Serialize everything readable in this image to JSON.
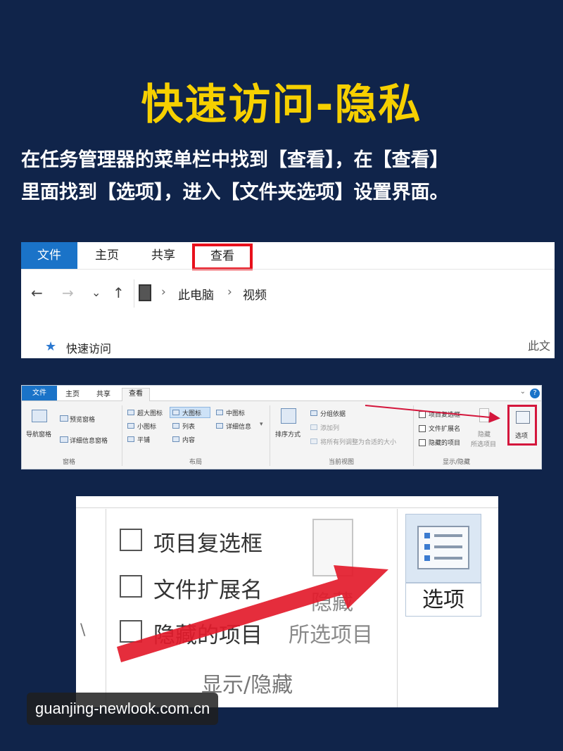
{
  "title": "快速访问-隐私",
  "description": {
    "line1": "在任务管理器的菜单栏中找到【查看】，在【查看】",
    "line2": "里面找到【选项】，进入【文件夹选项】设置界面。"
  },
  "panel1": {
    "tabs": [
      "文件",
      "主页",
      "共享",
      "查看"
    ],
    "nav": {
      "back": "←",
      "forward": "→",
      "dropdown": "⌄",
      "up": "↑"
    },
    "breadcrumb": [
      "此电脑",
      "视频"
    ],
    "quick_access": "快速访问",
    "right_cut": "此文"
  },
  "panel2": {
    "tabs": [
      "文件",
      "主页",
      "共享",
      "查看"
    ],
    "nav_pane": "导航窗格",
    "preview_pane": "预览窗格",
    "details_pane": "详细信息窗格",
    "group_panes": "窗格",
    "layout": {
      "extra_large": "超大图标",
      "large": "大图标",
      "medium": "中图标",
      "small": "小图标",
      "list": "列表",
      "details": "详细信息",
      "tiles": "平铺",
      "content": "内容",
      "group": "布局"
    },
    "current_view": {
      "sort": "排序方式",
      "group_by": "分组依据",
      "add_column": "添加列",
      "fit_columns": "将所有列调整为合适的大小",
      "group": "当前视图"
    },
    "show_hide": {
      "item_checkbox": "项目复选框",
      "extensions": "文件扩展名",
      "hidden_items": "隐藏的项目",
      "hide": "隐藏",
      "selected_items": "所选项目",
      "group": "显示/隐藏"
    },
    "options": "选项"
  },
  "panel3": {
    "item_checkbox": "项目复选框",
    "extensions": "文件扩展名",
    "hidden_items": "隐藏的项目",
    "hide": "隐藏",
    "selected_items": "所选项目",
    "options": "选项",
    "group": "显示/隐藏"
  },
  "watermark": "guanjing-newlook.com.cn",
  "colors": {
    "background": "#10244a",
    "title": "#f6d000",
    "highlight_red": "#e8101c",
    "file_tab_blue": "#1a73c8"
  }
}
